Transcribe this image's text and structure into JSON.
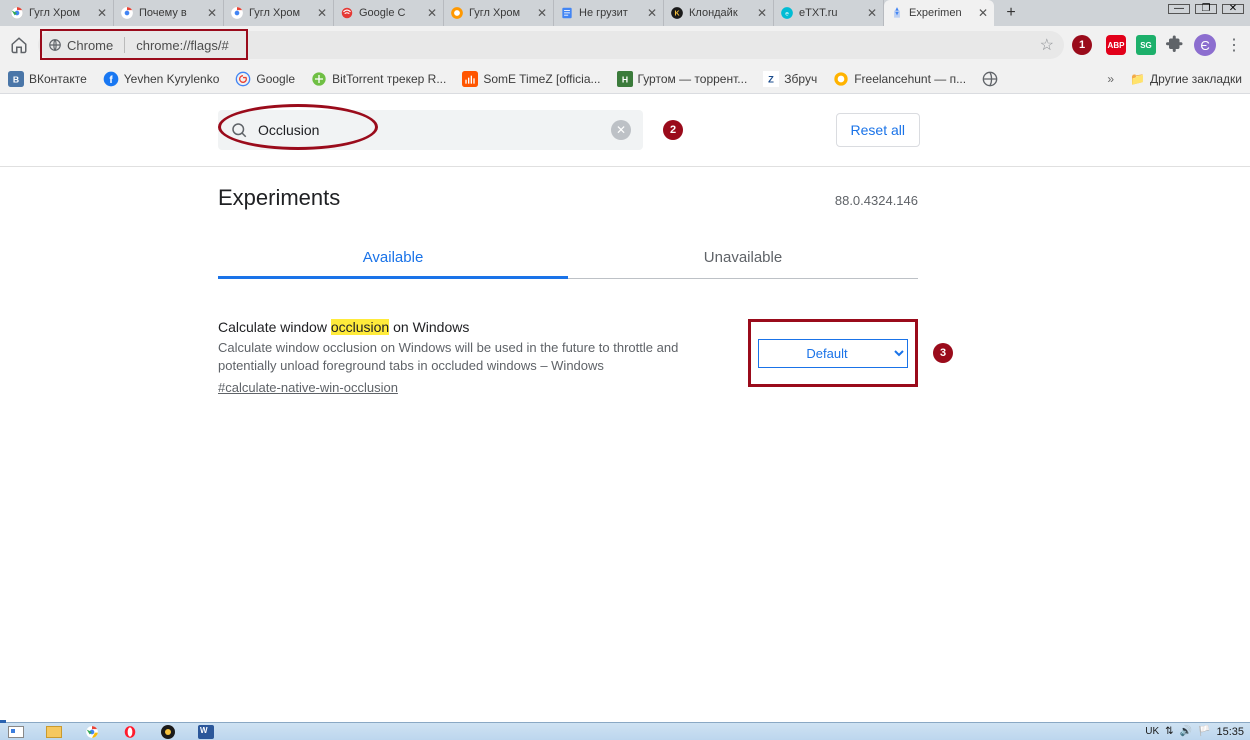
{
  "window_controls": {
    "minimize": "—",
    "maximize": "❐",
    "close": "✕"
  },
  "tabs": [
    {
      "title": "Гугл Хром",
      "fav_bg": "#fff"
    },
    {
      "title": "Почему в",
      "fav_bg": "#fff"
    },
    {
      "title": "Гугл Хром",
      "fav_bg": "#fff"
    },
    {
      "title": "Google C",
      "fav_bg": "#fff"
    },
    {
      "title": "Гугл Хром",
      "fav_bg": "#fff"
    },
    {
      "title": "Не грузит",
      "fav_bg": "#fff"
    },
    {
      "title": "Клондайк",
      "fav_bg": "#fff"
    },
    {
      "title": "eTXT.ru",
      "fav_bg": "#fff"
    },
    {
      "title": "Experimen",
      "fav_bg": "#fff",
      "active": true
    }
  ],
  "addr": {
    "chip_label": "Chrome",
    "url": "chrome://flags/#"
  },
  "callouts": {
    "one": "1",
    "two": "2",
    "three": "3"
  },
  "ext": {
    "abp": "ABP",
    "sg": "SG",
    "avatar": "Є"
  },
  "bookmarks": [
    {
      "label": "ВКонтакте"
    },
    {
      "label": "Yevhen Kyrylenko"
    },
    {
      "label": "Google"
    },
    {
      "label": "BitTorrent трекер R..."
    },
    {
      "label": "SomE TimeZ [officia..."
    },
    {
      "label": "Гуртом — торрент..."
    },
    {
      "label": "Збруч"
    },
    {
      "label": "Freelancehunt — п..."
    },
    {
      "label": ""
    }
  ],
  "other_bookmarks_label": "Другие закладки",
  "search": {
    "value": "Occlusion",
    "clear": "✕"
  },
  "reset_label": "Reset all",
  "experiments_title": "Experiments",
  "version": "88.0.4324.146",
  "flag_tabs": {
    "available": "Available",
    "unavailable": "Unavailable"
  },
  "flag": {
    "title_pre": "Calculate window ",
    "title_hl": "occlusion",
    "title_post": " on Windows",
    "desc": "Calculate window occlusion on Windows will be used in the future to throttle and potentially unload foreground tabs in occluded windows – Windows",
    "anchor": "#calculate-native-win-occlusion",
    "select_value": "Default"
  },
  "tray": {
    "lang": "UK",
    "clock": "15:35"
  }
}
